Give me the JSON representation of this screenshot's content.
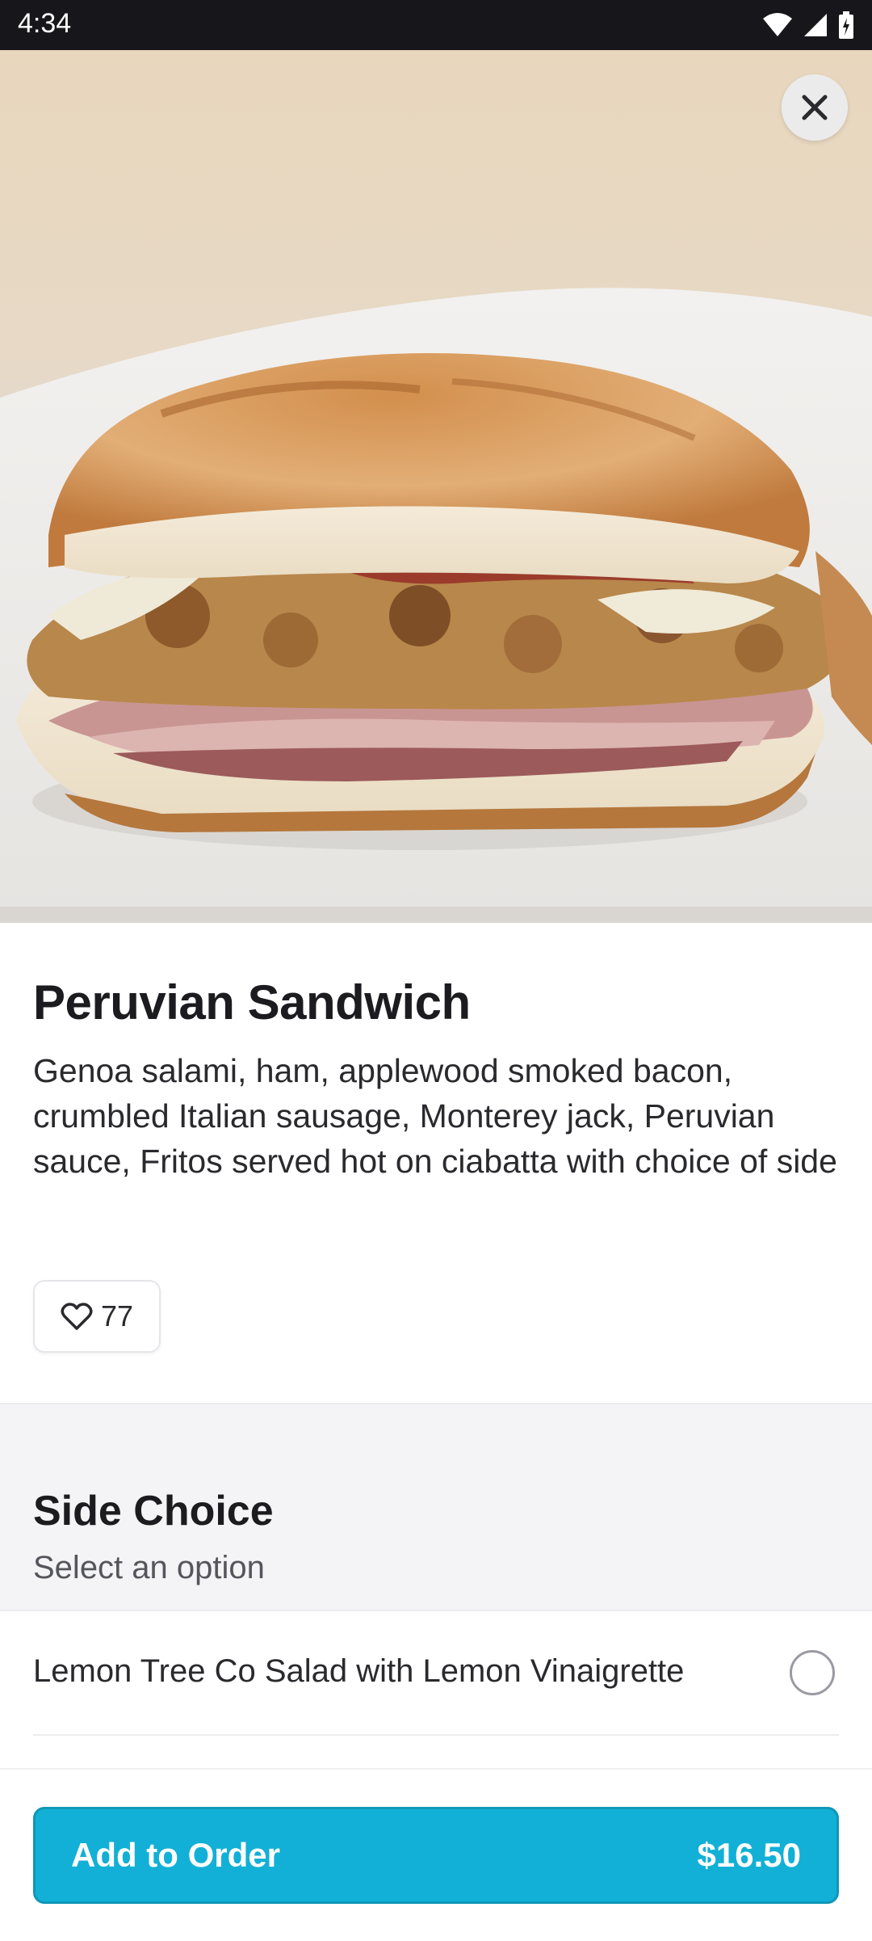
{
  "status_bar": {
    "time": "4:34",
    "icons": [
      "wifi-icon",
      "signal-icon",
      "battery-icon"
    ]
  },
  "hero": {
    "image": "sandwich-photo",
    "close_icon": "close-icon"
  },
  "item": {
    "title": "Peruvian Sandwich",
    "description": "Genoa salami, ham, applewood smoked bacon, crumbled Italian sausage, Monterey jack, Peruvian sauce, Fritos served hot on ciabatta with choice of side",
    "likes": "77",
    "like_icon": "heart-icon"
  },
  "side_choice": {
    "title": "Side Choice",
    "subtitle": "Select an option",
    "options": [
      {
        "label": "Lemon Tree Co Salad with Lemon Vinaigrette",
        "selected": false
      }
    ]
  },
  "bottom_bar": {
    "button_label": "Add to Order",
    "price": "$16.50",
    "accent_color": "#12b0d6"
  }
}
